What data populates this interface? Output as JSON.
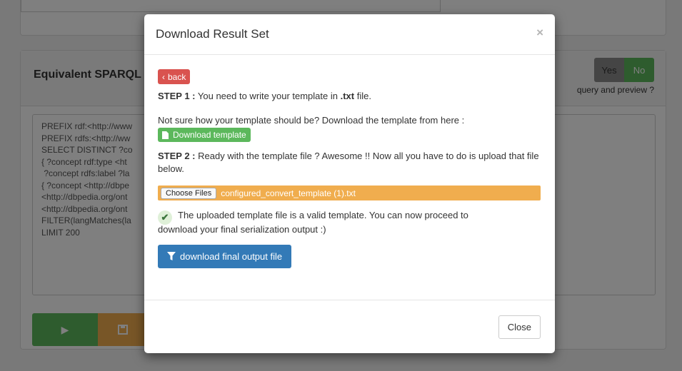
{
  "background": {
    "panel_title": "Equivalent SPARQL",
    "toggle": {
      "yes_label": "Yes",
      "no_label": "No"
    },
    "preview_label": "query and preview ?",
    "sparql_lines": [
      "PREFIX rdf:<http://www",
      "PREFIX rdfs:<http://ww",
      "SELECT DISTINCT ?co",
      "{ ?concept rdf:type <ht",
      " ?concept rdfs:label ?la",
      "{ ?concept <http://dbpe",
      "<http://dbpedia.org/ont",
      "<http://dbpedia.org/ont",
      "FILTER(langMatches(la",
      "LIMIT 200"
    ],
    "run_icon": "play-icon",
    "save_icon": "save-icon"
  },
  "modal": {
    "title": "Download Result Set",
    "close_x": "×",
    "back_label": "back",
    "step1_label": "STEP 1 :",
    "step1_text": " You need to write your template in ",
    "step1_ext": ".txt",
    "step1_end": " file.",
    "not_sure_text": "Not sure how your template should be? Download the template from here :",
    "download_template_label": "Download template",
    "step2_label": "STEP 2 :",
    "step2_text": " Ready with the template file ? Awesome !! Now all you have to do is upload that file below.",
    "choose_files_label": "Choose Files",
    "file_name": "configured_convert_template (1).txt",
    "valid_text_1": "The uploaded template file is a valid template. You can now proceed to",
    "valid_text_2": "download your final serialization output :)",
    "final_button_label": "download final output file",
    "close_label": "Close"
  },
  "colors": {
    "danger": "#d9534f",
    "success": "#5cb85c",
    "warning": "#f0ad4e",
    "primary": "#337ab7"
  }
}
